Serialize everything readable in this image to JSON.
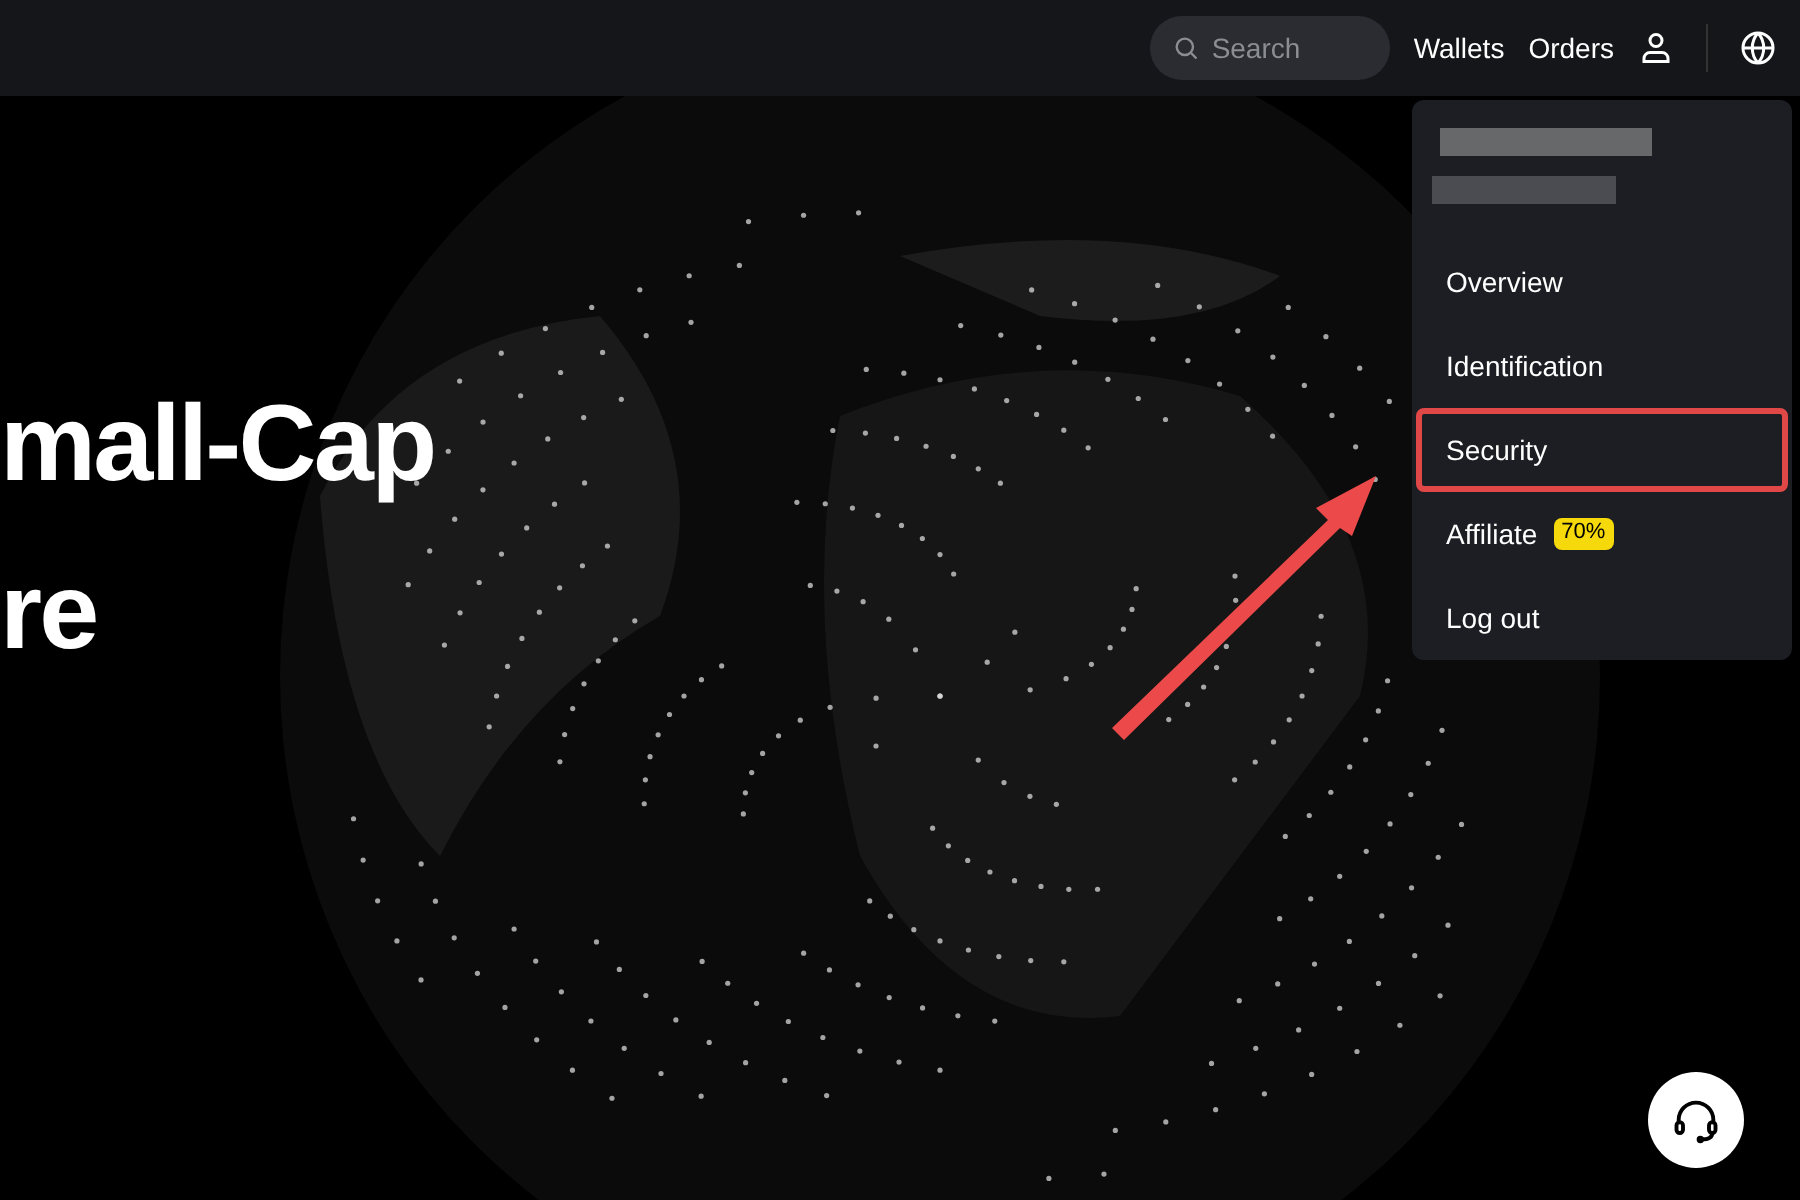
{
  "header": {
    "search": {
      "placeholder": "Search"
    },
    "links": [
      "Wallets",
      "Orders"
    ]
  },
  "hero": {
    "lines": [
      "mall-Cap",
      "re"
    ]
  },
  "account_menu": {
    "items": [
      {
        "label": "Overview",
        "highlighted": false
      },
      {
        "label": "Identification",
        "highlighted": false
      },
      {
        "label": "Security",
        "highlighted": true
      },
      {
        "label": "Affiliate",
        "badge": "70%",
        "highlighted": false
      },
      {
        "label": "Log out",
        "highlighted": false
      }
    ]
  }
}
